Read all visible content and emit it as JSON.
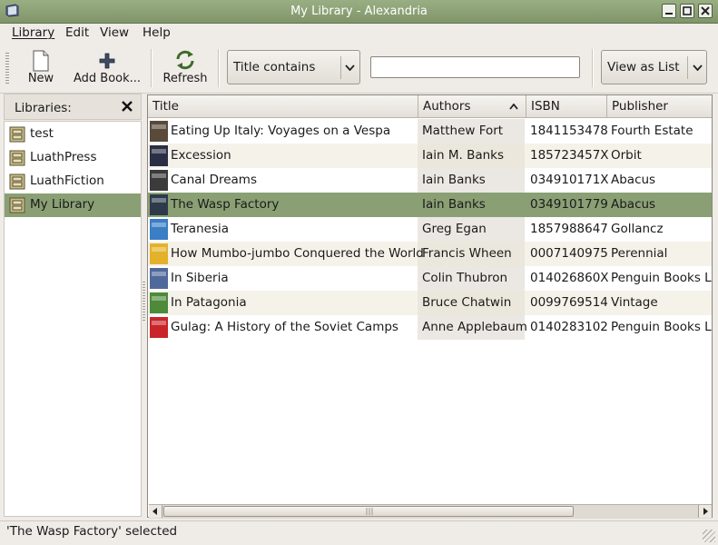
{
  "window": {
    "title": "My Library - Alexandria"
  },
  "menubar": {
    "items": [
      {
        "label": "Library",
        "underline": "L"
      },
      {
        "label": "Edit",
        "underline": "E"
      },
      {
        "label": "View",
        "underline": "V"
      },
      {
        "label": "Help",
        "underline": "H"
      }
    ]
  },
  "toolbar": {
    "new_label": "New",
    "add_label": "Add Book...",
    "refresh_label": "Refresh",
    "filter_selected": "Title contains",
    "search_value": "",
    "view_selected": "View as List"
  },
  "libraries": {
    "header": "Libraries:",
    "items": [
      {
        "name": "test",
        "selected": false
      },
      {
        "name": "LuathPress",
        "selected": false
      },
      {
        "name": "LuathFiction",
        "selected": false
      },
      {
        "name": "My Library",
        "selected": true
      }
    ]
  },
  "table": {
    "columns": [
      "Title",
      "Authors",
      "ISBN",
      "Publisher"
    ],
    "sorted_column": "Authors",
    "rows": [
      {
        "title": "Eating Up Italy: Voyages on a Vespa",
        "author": "Matthew Fort",
        "isbn": "1841153478",
        "publisher": "Fourth Estate",
        "cover_color": "#5a4a3a"
      },
      {
        "title": "Excession",
        "author": "Iain M. Banks",
        "isbn": "185723457X",
        "publisher": "Orbit",
        "cover_color": "#2a2f45"
      },
      {
        "title": "Canal Dreams",
        "author": "Iain Banks",
        "isbn": "034910171X",
        "publisher": "Abacus",
        "cover_color": "#3b3b3b"
      },
      {
        "title": "The Wasp Factory",
        "author": "Iain Banks",
        "isbn": "0349101779",
        "publisher": "Abacus",
        "cover_color": "#2d3a4a",
        "selected": true
      },
      {
        "title": "Teranesia",
        "author": "Greg Egan",
        "isbn": "1857988647",
        "publisher": "Gollancz",
        "cover_color": "#3a7ec4"
      },
      {
        "title": "How Mumbo-jumbo Conquered the World",
        "author": "Francis Wheen",
        "isbn": "0007140975",
        "publisher": "Perennial",
        "cover_color": "#e3b22a"
      },
      {
        "title": "In Siberia",
        "author": "Colin Thubron",
        "isbn": "014026860X",
        "publisher": "Penguin Books Lt",
        "cover_color": "#4f6a9a"
      },
      {
        "title": "In Patagonia",
        "author": "Bruce Chatwin",
        "isbn": "0099769514",
        "publisher": "Vintage",
        "cover_color": "#4d8a3a"
      },
      {
        "title": "Gulag: A History of the Soviet Camps",
        "author": "Anne Applebaum",
        "isbn": "0140283102",
        "publisher": "Penguin Books Lt",
        "cover_color": "#c8242a"
      }
    ]
  },
  "status": {
    "text": "'The Wasp Factory' selected"
  },
  "colors": {
    "selection": "#8aa074",
    "titlebar": "#8ba276"
  }
}
